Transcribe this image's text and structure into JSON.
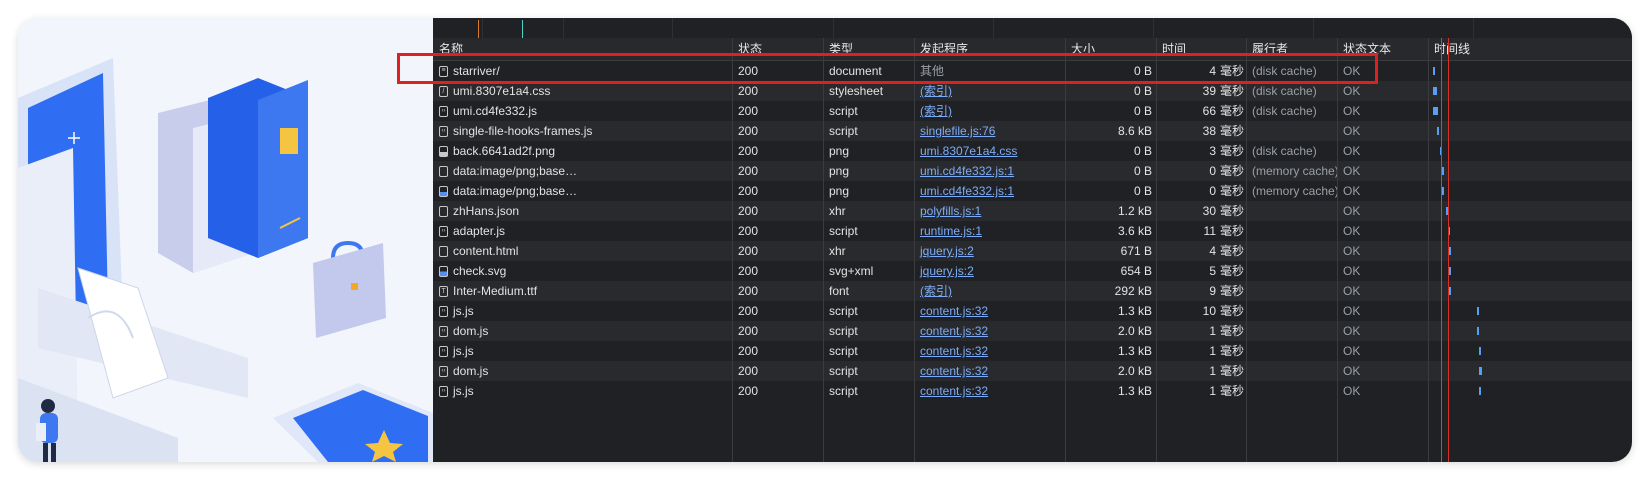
{
  "columns": {
    "name": "名称",
    "status": "状态",
    "type": "类型",
    "initiator": "发起程序",
    "size": "大小",
    "time": "时间",
    "fulfilled_by": "履行者",
    "status_text": "状态文本",
    "waterfall": "时间线"
  },
  "rows": [
    {
      "name": "starriver/",
      "icon": "doc",
      "status": "200",
      "type": "document",
      "initiator": "其他",
      "initiator_link": false,
      "size": "0 B",
      "time": "4",
      "unit": "毫秒",
      "fulfilled": "(disk cache)",
      "status_text": "OK"
    },
    {
      "name": "umi.8307e1a4.css",
      "icon": "css",
      "status": "200",
      "type": "stylesheet",
      "initiator": "(索引)",
      "initiator_link": true,
      "size": "0 B",
      "time": "39",
      "unit": "毫秒",
      "fulfilled": "(disk cache)",
      "status_text": "OK"
    },
    {
      "name": "umi.cd4fe332.js",
      "icon": "js",
      "status": "200",
      "type": "script",
      "initiator": "(索引)",
      "initiator_link": true,
      "size": "0 B",
      "time": "66",
      "unit": "毫秒",
      "fulfilled": "(disk cache)",
      "status_text": "OK"
    },
    {
      "name": "single-file-hooks-frames.js",
      "icon": "js",
      "status": "200",
      "type": "script",
      "initiator": "singlefile.js:76",
      "initiator_link": true,
      "size": "8.6 kB",
      "time": "38",
      "unit": "毫秒",
      "fulfilled": "",
      "status_text": "OK"
    },
    {
      "name": "back.6641ad2f.png",
      "icon": "img",
      "status": "200",
      "type": "png",
      "initiator": "umi.8307e1a4.css",
      "initiator_link": true,
      "size": "0 B",
      "time": "3",
      "unit": "毫秒",
      "fulfilled": "(disk cache)",
      "status_text": "OK"
    },
    {
      "name": "data:image/png;base…",
      "icon": "blank",
      "status": "200",
      "type": "png",
      "initiator": "umi.cd4fe332.js:1",
      "initiator_link": true,
      "size": "0 B",
      "time": "0",
      "unit": "毫秒",
      "fulfilled": "(memory cache)",
      "status_text": "OK"
    },
    {
      "name": "data:image/png;base…",
      "icon": "imgb",
      "status": "200",
      "type": "png",
      "initiator": "umi.cd4fe332.js:1",
      "initiator_link": true,
      "size": "0 B",
      "time": "0",
      "unit": "毫秒",
      "fulfilled": "(memory cache)",
      "status_text": "OK"
    },
    {
      "name": "zhHans.json",
      "icon": "blank",
      "status": "200",
      "type": "xhr",
      "initiator": "polyfills.js:1",
      "initiator_link": true,
      "size": "1.2 kB",
      "time": "30",
      "unit": "毫秒",
      "fulfilled": "",
      "status_text": "OK"
    },
    {
      "name": "adapter.js",
      "icon": "js",
      "status": "200",
      "type": "script",
      "initiator": "runtime.js:1",
      "initiator_link": true,
      "size": "3.6 kB",
      "time": "11",
      "unit": "毫秒",
      "fulfilled": "",
      "status_text": "OK"
    },
    {
      "name": "content.html",
      "icon": "blank",
      "status": "200",
      "type": "xhr",
      "initiator": "jquery.js:2",
      "initiator_link": true,
      "size": "671 B",
      "time": "4",
      "unit": "毫秒",
      "fulfilled": "",
      "status_text": "OK"
    },
    {
      "name": "check.svg",
      "icon": "svg",
      "status": "200",
      "type": "svg+xml",
      "initiator": "jquery.js:2",
      "initiator_link": true,
      "size": "654 B",
      "time": "5",
      "unit": "毫秒",
      "fulfilled": "",
      "status_text": "OK"
    },
    {
      "name": "Inter-Medium.ttf",
      "icon": "font",
      "status": "200",
      "type": "font",
      "initiator": "(索引)",
      "initiator_link": true,
      "size": "292 kB",
      "time": "9",
      "unit": "毫秒",
      "fulfilled": "",
      "status_text": "OK"
    },
    {
      "name": "js.js",
      "icon": "js",
      "status": "200",
      "type": "script",
      "initiator": "content.js:32",
      "initiator_link": true,
      "size": "1.3 kB",
      "time": "10",
      "unit": "毫秒",
      "fulfilled": "",
      "status_text": "OK"
    },
    {
      "name": "dom.js",
      "icon": "js",
      "status": "200",
      "type": "script",
      "initiator": "content.js:32",
      "initiator_link": true,
      "size": "2.0 kB",
      "time": "1",
      "unit": "毫秒",
      "fulfilled": "",
      "status_text": "OK"
    },
    {
      "name": "js.js",
      "icon": "js",
      "status": "200",
      "type": "script",
      "initiator": "content.js:32",
      "initiator_link": true,
      "size": "1.3 kB",
      "time": "1",
      "unit": "毫秒",
      "fulfilled": "",
      "status_text": "OK"
    },
    {
      "name": "dom.js",
      "icon": "js",
      "status": "200",
      "type": "script",
      "initiator": "content.js:32",
      "initiator_link": true,
      "size": "2.0 kB",
      "time": "1",
      "unit": "毫秒",
      "fulfilled": "",
      "status_text": "OK"
    },
    {
      "name": "js.js",
      "icon": "js",
      "status": "200",
      "type": "script",
      "initiator": "content.js:32",
      "initiator_link": true,
      "size": "1.3 kB",
      "time": "1",
      "unit": "毫秒",
      "fulfilled": "",
      "status_text": "OK"
    }
  ],
  "colors": {
    "highlight": "#e02020",
    "link": "#7cacf8",
    "waterfall_bar": "#5b9cf5",
    "dom_content_loaded": "#3b6fe0",
    "load_event": "#d93025"
  }
}
